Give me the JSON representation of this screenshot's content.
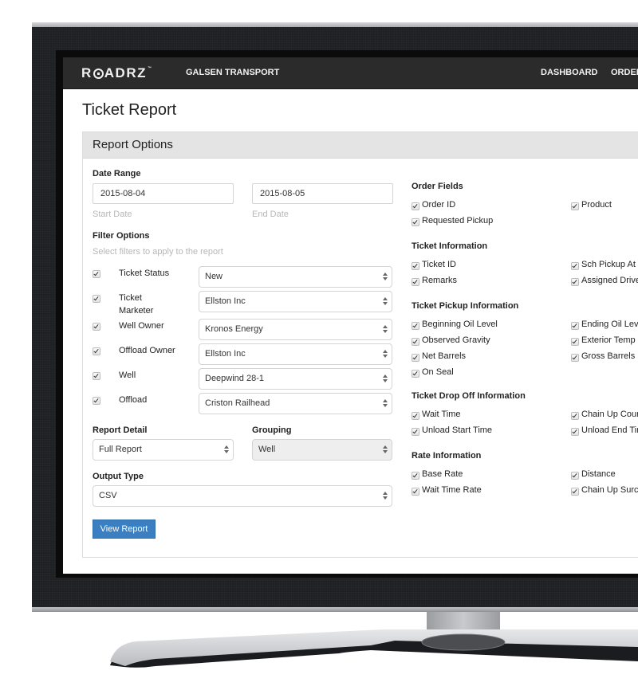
{
  "navbar": {
    "logo_text_pre": "R",
    "logo_text_post": "ADRZ",
    "logo_tm": "™",
    "company": "GALSEN TRANSPORT",
    "links": [
      {
        "label": "DASHBOARD"
      },
      {
        "label": "ORDERS"
      }
    ]
  },
  "page": {
    "title": "Ticket Report"
  },
  "panel": {
    "heading": "Report Options"
  },
  "date_range": {
    "label": "Date Range",
    "start_value": "2015-08-04",
    "start_help": "Start Date",
    "end_value": "2015-08-05",
    "end_help": "End Date"
  },
  "filter_options": {
    "label": "Filter Options",
    "help": "Select filters to apply to the report",
    "filters": [
      {
        "label": "Ticket Status",
        "value": "New",
        "checked": true
      },
      {
        "label": "Ticket Marketer",
        "value": "Ellston Inc",
        "checked": true
      },
      {
        "label": "Well Owner",
        "value": "Kronos Energy",
        "checked": true
      },
      {
        "label": "Offload Owner",
        "value": "Ellston Inc",
        "checked": true
      },
      {
        "label": "Well",
        "value": "Deepwind 28-1",
        "checked": true
      },
      {
        "label": "Offload",
        "value": "Criston Railhead",
        "checked": true
      }
    ]
  },
  "report_detail": {
    "label": "Report Detail",
    "value": "Full Report"
  },
  "grouping": {
    "label": "Grouping",
    "value": "Well",
    "disabled": true
  },
  "output_type": {
    "label": "Output Type",
    "value": "CSV"
  },
  "view_report_label": "View Report",
  "field_groups": [
    {
      "title": "Order Fields",
      "fields": [
        "Order ID",
        "Product",
        "Requested Pickup"
      ]
    },
    {
      "title": "Ticket Information",
      "fields": [
        "Ticket ID",
        "Sch Pickup At",
        "Remarks",
        "Assigned Driver"
      ]
    },
    {
      "title": "Ticket Pickup Information",
      "fields": [
        "Beginning Oil Level",
        "Ending Oil Level",
        "Observed Gravity",
        "Exterior Temp",
        "Net Barrels",
        "Gross Barrels",
        "On Seal"
      ]
    },
    {
      "title": "Ticket Drop Off Information",
      "fields": [
        "Wait Time",
        "Chain Up Count",
        "Unload Start Time",
        "Unload End Time"
      ]
    },
    {
      "title": "Rate Information",
      "fields": [
        "Base Rate",
        "Distance",
        "Wait Time Rate",
        "Chain Up Surcharge"
      ]
    }
  ]
}
